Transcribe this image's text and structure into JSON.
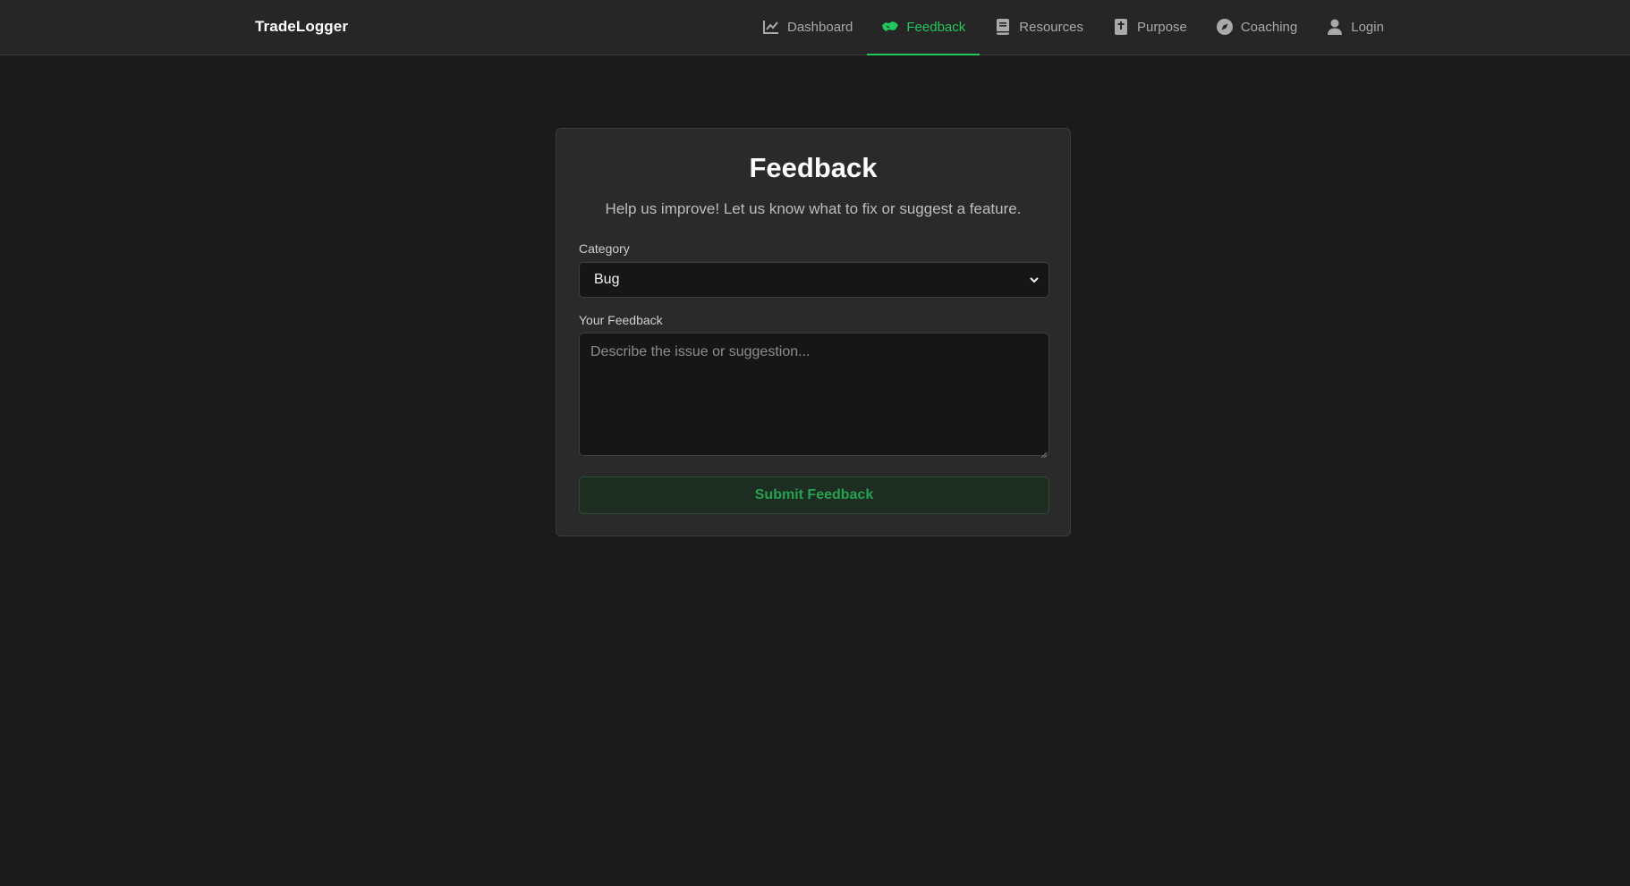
{
  "app": {
    "brand": "TradeLogger"
  },
  "nav": {
    "items": [
      {
        "label": "Dashboard",
        "icon": "chart-line-icon",
        "active": false
      },
      {
        "label": "Feedback",
        "icon": "handshake-icon",
        "active": true
      },
      {
        "label": "Resources",
        "icon": "book-icon",
        "active": false
      },
      {
        "label": "Purpose",
        "icon": "bible-icon",
        "active": false
      },
      {
        "label": "Coaching",
        "icon": "compass-icon",
        "active": false
      },
      {
        "label": "Login",
        "icon": "user-icon",
        "active": false
      }
    ]
  },
  "form": {
    "title": "Feedback",
    "subtitle": "Help us improve! Let us know what to fix or suggest a feature.",
    "category_label": "Category",
    "category_value": "Bug",
    "feedback_label": "Your Feedback",
    "feedback_placeholder": "Describe the issue or suggestion...",
    "feedback_value": "",
    "submit_label": "Submit Feedback"
  },
  "colors": {
    "background": "#1b1b1b",
    "navbar": "#262626",
    "card": "#2a2a2a",
    "accent": "#22c55e",
    "muted_text": "#a9a9a9"
  }
}
